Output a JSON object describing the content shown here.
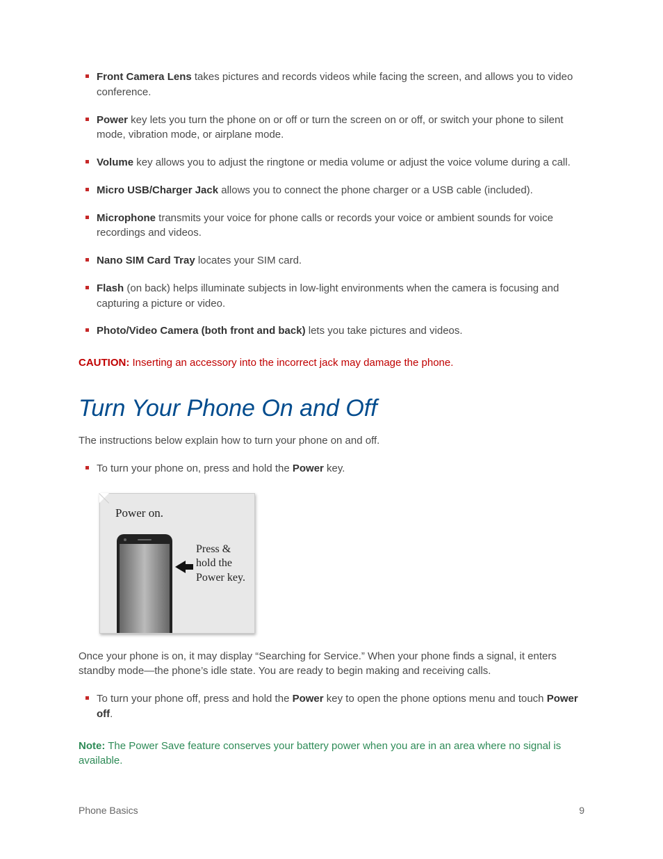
{
  "features": [
    {
      "bold": "Front Camera Lens",
      "rest": " takes pictures and records videos while facing the screen, and allows you to video conference."
    },
    {
      "bold": "Power",
      "rest": " key lets you turn the phone on or off or turn the screen on or off, or switch your phone to silent mode, vibration mode, or airplane mode."
    },
    {
      "bold": "Volume",
      "rest": " key allows you to adjust the ringtone or media volume or adjust the voice volume during a call."
    },
    {
      "bold": "Micro USB/Charger Jack",
      "rest": " allows you to connect the phone charger or a USB cable (included)."
    },
    {
      "bold": "Microphone",
      "rest": " transmits your voice for phone calls or records your voice or ambient sounds for voice recordings and videos."
    },
    {
      "bold": "Nano SIM Card Tray",
      "rest": " locates your SIM card."
    },
    {
      "bold": "Flash",
      "rest": " (on back) helps illuminate subjects in low-light environments when the camera is focusing and capturing a picture or video."
    },
    {
      "bold": "Photo/Video Camera (both front and back)",
      "rest": " lets you take pictures and videos."
    }
  ],
  "caution_label": "CAUTION:",
  "caution_text": " Inserting an accessory into the incorrect jack may damage the phone.",
  "section_heading": "Turn Your Phone On and Off",
  "intro": "The instructions below explain how to turn your phone on and off.",
  "step_on_pre": "To turn your phone on, press and hold the ",
  "step_on_bold": "Power",
  "step_on_post": " key.",
  "figure_title": "Power on.",
  "figure_caption": "Press & hold the Power key.",
  "standby": "Once your phone is on, it may display “Searching for Service.” When your phone finds a signal, it enters standby mode—the phone’s idle state. You are ready to begin making and receiving calls.",
  "step_off_pre": "To turn your phone off, press and hold the ",
  "step_off_bold1": "Power",
  "step_off_mid": " key to open the phone options menu and touch ",
  "step_off_bold2": "Power off",
  "step_off_post": ".",
  "note_label": "Note:",
  "note_text": " The Power Save feature conserves your battery power when you are in an area where no signal is available.",
  "footer_left": "Phone Basics",
  "footer_right": "9"
}
